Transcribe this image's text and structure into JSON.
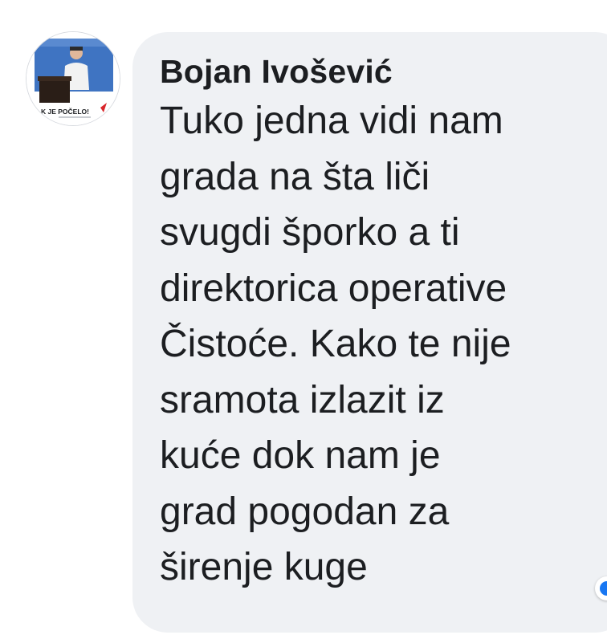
{
  "comment": {
    "author": "Bojan Ivošević",
    "avatar": {
      "icon": "profile-photo-icon",
      "banner_text": "K JE POČELO!"
    },
    "text_lines": [
      "Tuko jedna vidi nam",
      "grada na šta liči",
      "svugdi šporko a ti",
      "direktorica operative",
      "Čistoće. Kako te nije",
      "sramota izlazit iz",
      "kuće dok nam je",
      "grad pogodan za",
      "širenje kuge"
    ]
  },
  "reaction": {
    "icon": "like-reaction-icon"
  },
  "colors": {
    "bubble_background": "#eff1f4",
    "text": "#1c1e21",
    "reaction_blue": "#1877f2"
  }
}
